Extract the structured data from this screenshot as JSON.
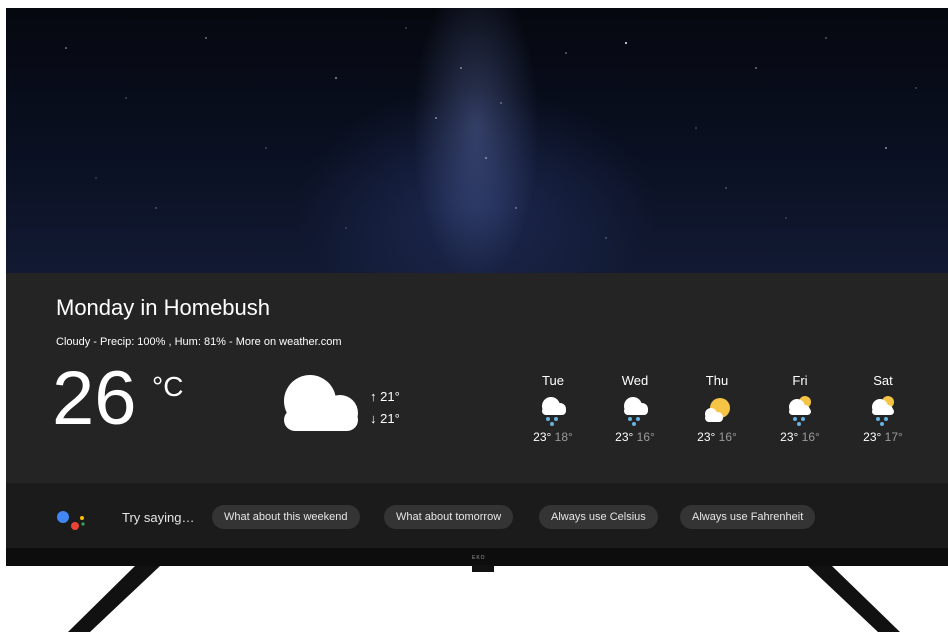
{
  "weather": {
    "title": "Monday in Homebush",
    "subtitle": "Cloudy - Precip: 100%  ,  Hum: 81% - More on weather.com",
    "temperature": "26",
    "unit": "°C",
    "high": "↑ 21°",
    "low": "↓ 21°",
    "condition_icon": "cloud-icon"
  },
  "forecast": [
    {
      "day": "Tue",
      "high": "23°",
      "low": "18°",
      "icon": "snow-cloud-icon"
    },
    {
      "day": "Wed",
      "high": "23°",
      "low": "16°",
      "icon": "snow-cloud-icon"
    },
    {
      "day": "Thu",
      "high": "23°",
      "low": "16°",
      "icon": "partly-cloudy-sun-icon"
    },
    {
      "day": "Fri",
      "high": "23°",
      "low": "16°",
      "icon": "snow-sun-cloud-icon"
    },
    {
      "day": "Sat",
      "high": "23°",
      "low": "17°",
      "icon": "snow-sun-cloud-icon"
    }
  ],
  "assistant": {
    "try_label": "Try saying…",
    "suggestions": [
      "What about this weekend",
      "What about tomorrow",
      "Always use Celsius",
      "Always use Fahrenheit"
    ],
    "icon": "google-assistant-icon"
  },
  "tv": {
    "brand": "EKO"
  },
  "colors": {
    "panel": "#242424",
    "bar": "#1b1b1b",
    "chip": "#343434",
    "sun": "#f6c445",
    "snow": "#66b3e0"
  }
}
